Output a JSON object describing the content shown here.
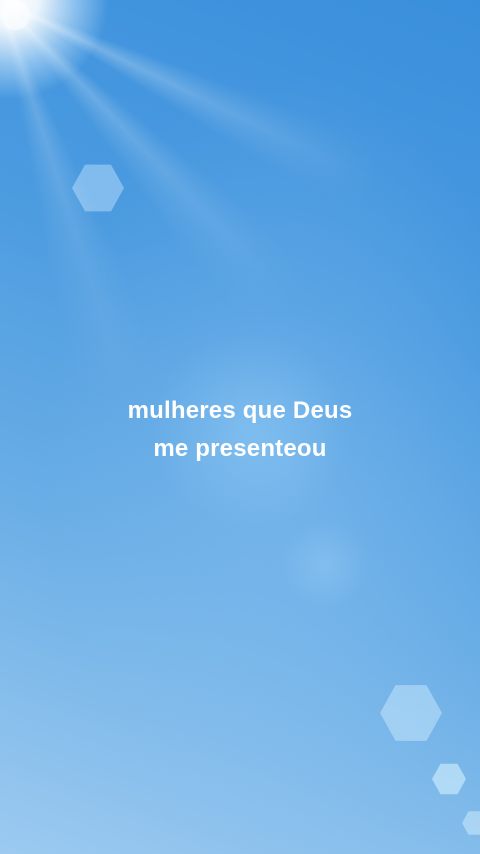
{
  "background": {
    "top_color": "#3a8fdc",
    "bottom_color": "#9ccaf0",
    "description_icon": "sun-glare"
  },
  "caption": {
    "line1": "mulheres que Deus",
    "line2": "me presenteou",
    "color": "#ffffff"
  }
}
